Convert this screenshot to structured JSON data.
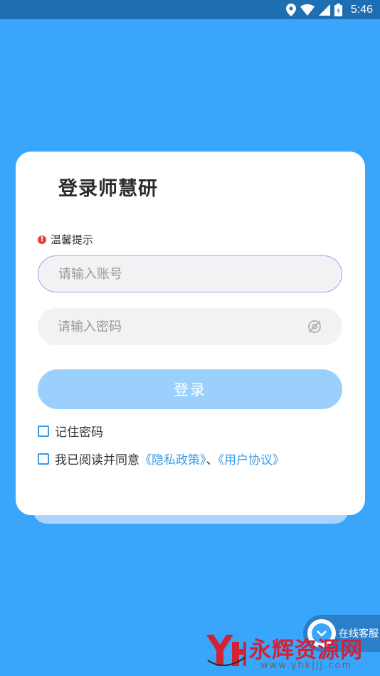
{
  "status_bar": {
    "time": "5:46",
    "icons": [
      "location-icon",
      "wifi-icon",
      "signal-icon",
      "battery-icon"
    ]
  },
  "login": {
    "title": "登录师慧研",
    "tip_label": "温馨提示",
    "account_placeholder": "请输入账号",
    "password_placeholder": "请输入密码",
    "login_button": "登录",
    "remember_label": "记住密码",
    "agree_prefix": "我已阅读并同意",
    "privacy_link": "《隐私政策》",
    "separator": "、",
    "user_agreement_link": "《用户协议》"
  },
  "service": {
    "label": "在线客服"
  },
  "watermark": {
    "text": "永辉资源网",
    "url": "www.yhkjjj.com"
  },
  "colors": {
    "background": "#3aa6fb",
    "status_bar": "#1d6fb1",
    "login_button": "#9bd0fc",
    "link": "#3a9be4",
    "tip_icon": "#e2433d"
  }
}
